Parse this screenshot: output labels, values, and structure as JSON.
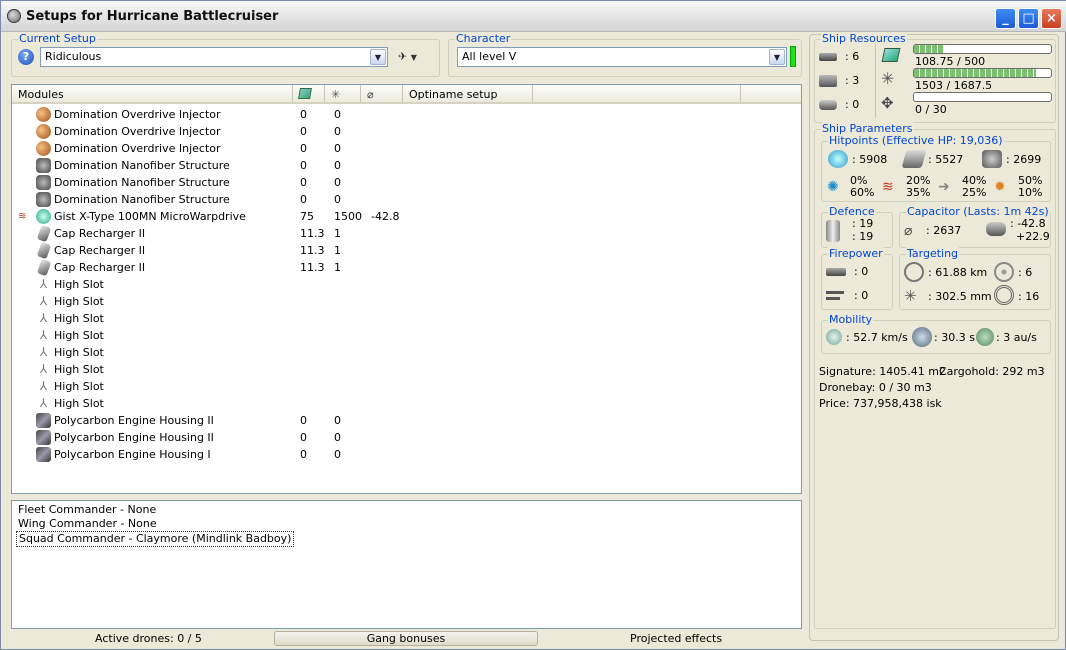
{
  "window": {
    "title": "Setups for Hurricane Battlecruiser"
  },
  "current_setup": {
    "group_label": "Current Setup",
    "value": "Ridiculous"
  },
  "character": {
    "group_label": "Character",
    "value": "All level V"
  },
  "modules": {
    "headers": {
      "name": "Modules",
      "col4": "Optiname setup"
    },
    "rows": [
      {
        "name": "Domination Overdrive Injector",
        "c1": "0",
        "c2": "0",
        "c3": "",
        "icon": "overdrive-icon"
      },
      {
        "name": "Domination Overdrive Injector",
        "c1": "0",
        "c2": "0",
        "c3": "",
        "icon": "overdrive-icon"
      },
      {
        "name": "Domination Overdrive Injector",
        "c1": "0",
        "c2": "0",
        "c3": "",
        "icon": "overdrive-icon"
      },
      {
        "name": "Domination Nanofiber Structure",
        "c1": "0",
        "c2": "0",
        "c3": "",
        "icon": "nanofiber-icon"
      },
      {
        "name": "Domination Nanofiber Structure",
        "c1": "0",
        "c2": "0",
        "c3": "",
        "icon": "nanofiber-icon"
      },
      {
        "name": "Domination Nanofiber Structure",
        "c1": "0",
        "c2": "0",
        "c3": "",
        "icon": "nanofiber-icon"
      },
      {
        "name": "Gist X-Type 100MN MicroWarpdrive",
        "c1": "75",
        "c2": "1500",
        "c3": "-42.8",
        "icon": "mwd-icon",
        "heat": true
      },
      {
        "name": "Cap Recharger II",
        "c1": "11.3",
        "c2": "1",
        "c3": "",
        "icon": "cap-recharger-icon"
      },
      {
        "name": "Cap Recharger II",
        "c1": "11.3",
        "c2": "1",
        "c3": "",
        "icon": "cap-recharger-icon"
      },
      {
        "name": "Cap Recharger II",
        "c1": "11.3",
        "c2": "1",
        "c3": "",
        "icon": "cap-recharger-icon"
      },
      {
        "name": "High Slot",
        "c1": "",
        "c2": "",
        "c3": "",
        "icon": "high-slot-icon"
      },
      {
        "name": "High Slot",
        "c1": "",
        "c2": "",
        "c3": "",
        "icon": "high-slot-icon"
      },
      {
        "name": "High Slot",
        "c1": "",
        "c2": "",
        "c3": "",
        "icon": "high-slot-icon"
      },
      {
        "name": "High Slot",
        "c1": "",
        "c2": "",
        "c3": "",
        "icon": "high-slot-icon"
      },
      {
        "name": "High Slot",
        "c1": "",
        "c2": "",
        "c3": "",
        "icon": "high-slot-icon"
      },
      {
        "name": "High Slot",
        "c1": "",
        "c2": "",
        "c3": "",
        "icon": "high-slot-icon"
      },
      {
        "name": "High Slot",
        "c1": "",
        "c2": "",
        "c3": "",
        "icon": "high-slot-icon"
      },
      {
        "name": "High Slot",
        "c1": "",
        "c2": "",
        "c3": "",
        "icon": "high-slot-icon"
      },
      {
        "name": "Polycarbon Engine Housing II",
        "c1": "0",
        "c2": "0",
        "c3": "",
        "icon": "rig-icon"
      },
      {
        "name": "Polycarbon Engine Housing II",
        "c1": "0",
        "c2": "0",
        "c3": "",
        "icon": "rig-icon"
      },
      {
        "name": "Polycarbon Engine Housing I",
        "c1": "0",
        "c2": "0",
        "c3": "",
        "icon": "rig-icon"
      }
    ]
  },
  "fleet": {
    "fleet_commander": "Fleet Commander - None",
    "wing_commander": "Wing Commander - None",
    "squad_commander": "Squad Commander - Claymore (Mindlink Badboy)"
  },
  "statusbar": {
    "active_drones": "Active drones: 0 / 5",
    "gang_bonuses": "Gang bonuses",
    "projected": "Projected effects"
  },
  "resources": {
    "title": "Ship Resources",
    "turrets": ": 6",
    "launchers": ": 3",
    "drones": ": 0",
    "cpu_text": "108.75 / 500",
    "cpu_fraction": 0.2175,
    "pg_text": "1503 / 1687.5",
    "pg_fraction": 0.8907,
    "calib_text": "0 / 30",
    "calib_fraction": 0
  },
  "params": {
    "title": "Ship Parameters",
    "hp_title": "Hitpoints (Effective HP: 19,036)",
    "shield": ": 5908",
    "armor": ": 5527",
    "structure": ": 2699",
    "em": [
      "0%",
      "60%"
    ],
    "thermal": [
      "20%",
      "35%"
    ],
    "kinetic": [
      "40%",
      "25%"
    ],
    "explosive": [
      "50%",
      "10%"
    ],
    "defence_title": "Defence",
    "def1": ": 19",
    "def2": ": 19",
    "cap_title": "Capacitor (Lasts: 1m 42s)",
    "cap_amount": ": 2637",
    "cap_rate1": ": -42.8",
    "cap_rate2": "+22.9",
    "fire_title": "Firepower",
    "fire1": ": 0",
    "fire2": ": 0",
    "target_title": "Targeting",
    "range": ": 61.88 km",
    "max_targets": ": 6",
    "scanres": ": 302.5 mm",
    "sensor": ": 16",
    "mob_title": "Mobility",
    "speed": ": 52.7 km/s",
    "align": ": 30.3 s",
    "warp": ": 3 au/s",
    "signature": "Signature: 1405.41 m2",
    "cargo": "Cargohold: 292 m3",
    "dronebay": "Dronebay: 0 / 30 m3",
    "price": "Price: 737,958,438 isk"
  },
  "colors": {
    "accent": "#0046d5",
    "cap_indicator": "#22dd22"
  }
}
